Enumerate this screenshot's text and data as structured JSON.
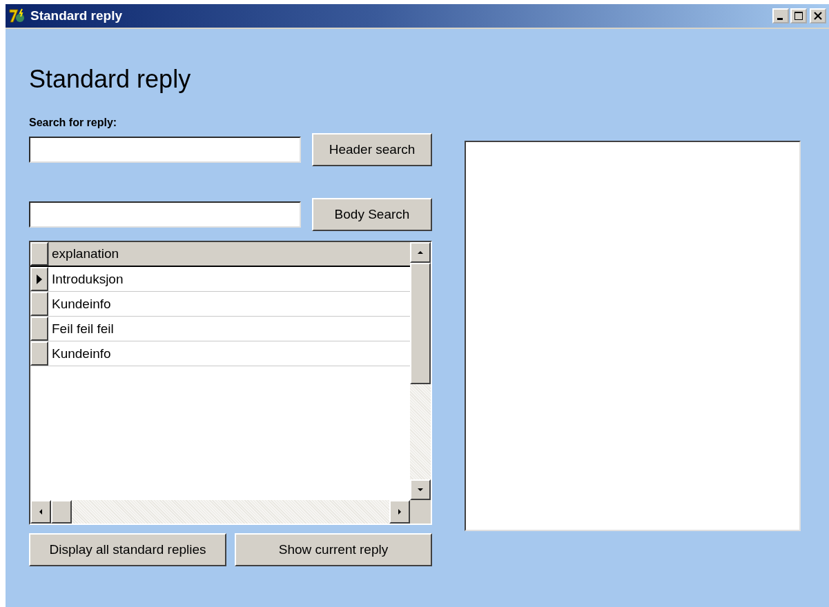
{
  "window": {
    "title": "Standard reply"
  },
  "heading": "Standard reply",
  "search_label": "Search for reply:",
  "header_search": {
    "button": "Header search"
  },
  "body_search": {
    "button": "Body Search"
  },
  "table": {
    "columns": [
      "explanation"
    ],
    "rows": [
      {
        "explanation": "Introduksjon",
        "selected": true
      },
      {
        "explanation": "Kundeinfo",
        "selected": false
      },
      {
        "explanation": "Feil feil feil",
        "selected": false
      },
      {
        "explanation": "Kundeinfo",
        "selected": false
      }
    ]
  },
  "buttons": [
    "Display all standard replies",
    "Show current reply"
  ]
}
